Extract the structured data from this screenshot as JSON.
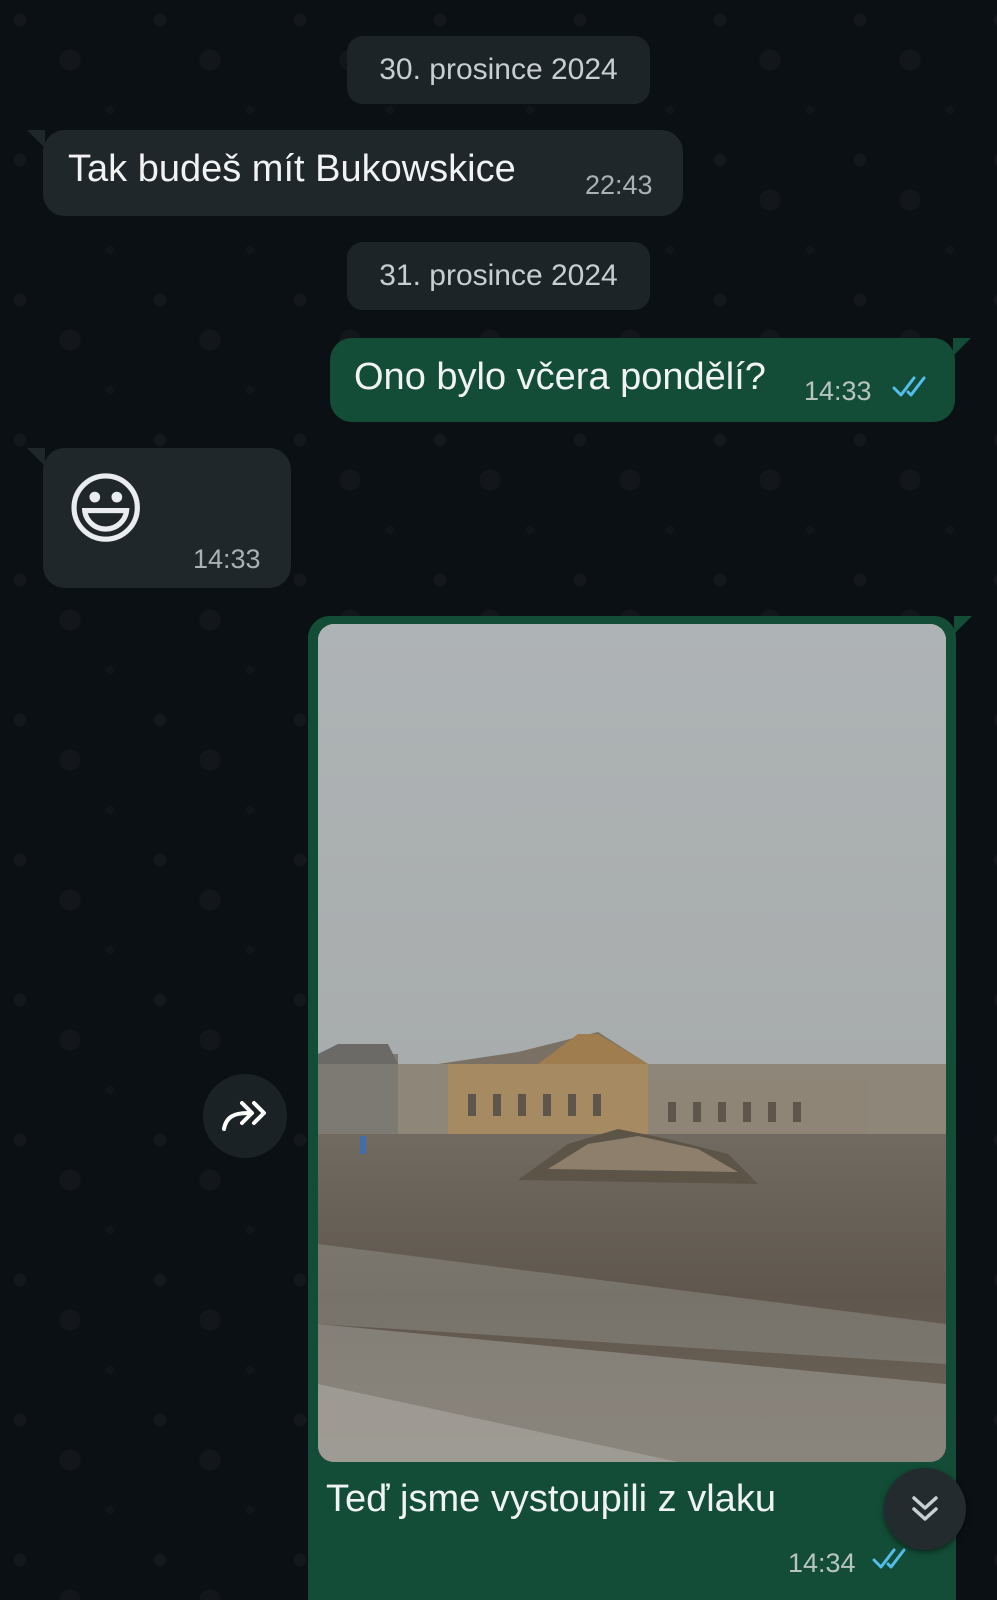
{
  "chat": {
    "date_1": "30. prosince 2024",
    "date_2": "31. prosince 2024",
    "messages": [
      {
        "direction": "incoming",
        "text": "Tak budeš mít Bukowskice",
        "time": "22:43"
      },
      {
        "direction": "outgoing",
        "text": "Ono bylo včera pondělí?",
        "time": "14:33",
        "status": "read"
      },
      {
        "direction": "incoming",
        "emoji": "😃",
        "time": "14:33"
      },
      {
        "direction": "outgoing",
        "type": "image",
        "caption": "Teď jsme vystoupili z vlaku",
        "time": "14:34",
        "status": "read"
      }
    ]
  },
  "colors": {
    "background": "#0b1014",
    "incoming_bubble": "#1f272a",
    "outgoing_bubble": "#134d37",
    "read_ticks": "#53bdeb"
  },
  "icons": {
    "forward": "forward-icon",
    "scroll_down": "double-chevron-down-icon",
    "read_status": "double-check-icon"
  }
}
